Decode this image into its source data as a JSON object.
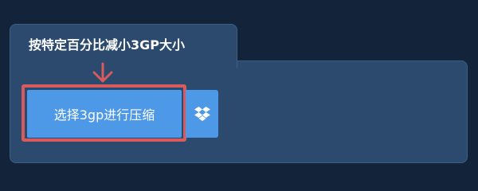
{
  "tab": {
    "title": "按特定百分比减小3GP大小"
  },
  "upload": {
    "select_button_label": "选择3gp进行压缩",
    "dropbox_icon": "dropbox-icon"
  },
  "annotation": {
    "arrow_icon": "arrow-down-icon",
    "highlight_color": "#d75a5d"
  },
  "colors": {
    "background": "#12233a",
    "panel": "#2b4a6d",
    "button": "#4d99e8"
  }
}
